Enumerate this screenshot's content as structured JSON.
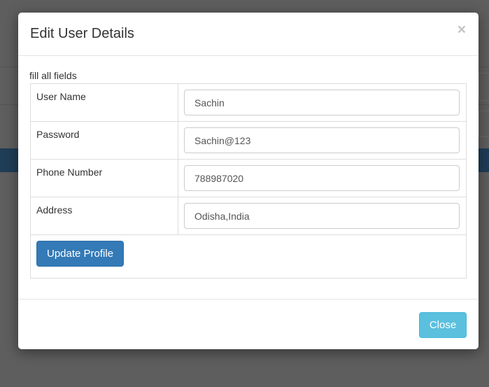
{
  "modal": {
    "title": "Edit User Details",
    "close_glyph": "×",
    "hint": "fill all fields",
    "fields": [
      {
        "label": "User Name",
        "value": "Sachin"
      },
      {
        "label": "Password",
        "value": "Sachin@123"
      },
      {
        "label": "Phone Number",
        "value": "788987020"
      },
      {
        "label": "Address",
        "value": "Odisha,India"
      }
    ],
    "update_label": "Update Profile",
    "close_label": "Close"
  },
  "colors": {
    "primary": "#337ab7",
    "info": "#5bc0de",
    "overlay": "#5e5e5e"
  }
}
